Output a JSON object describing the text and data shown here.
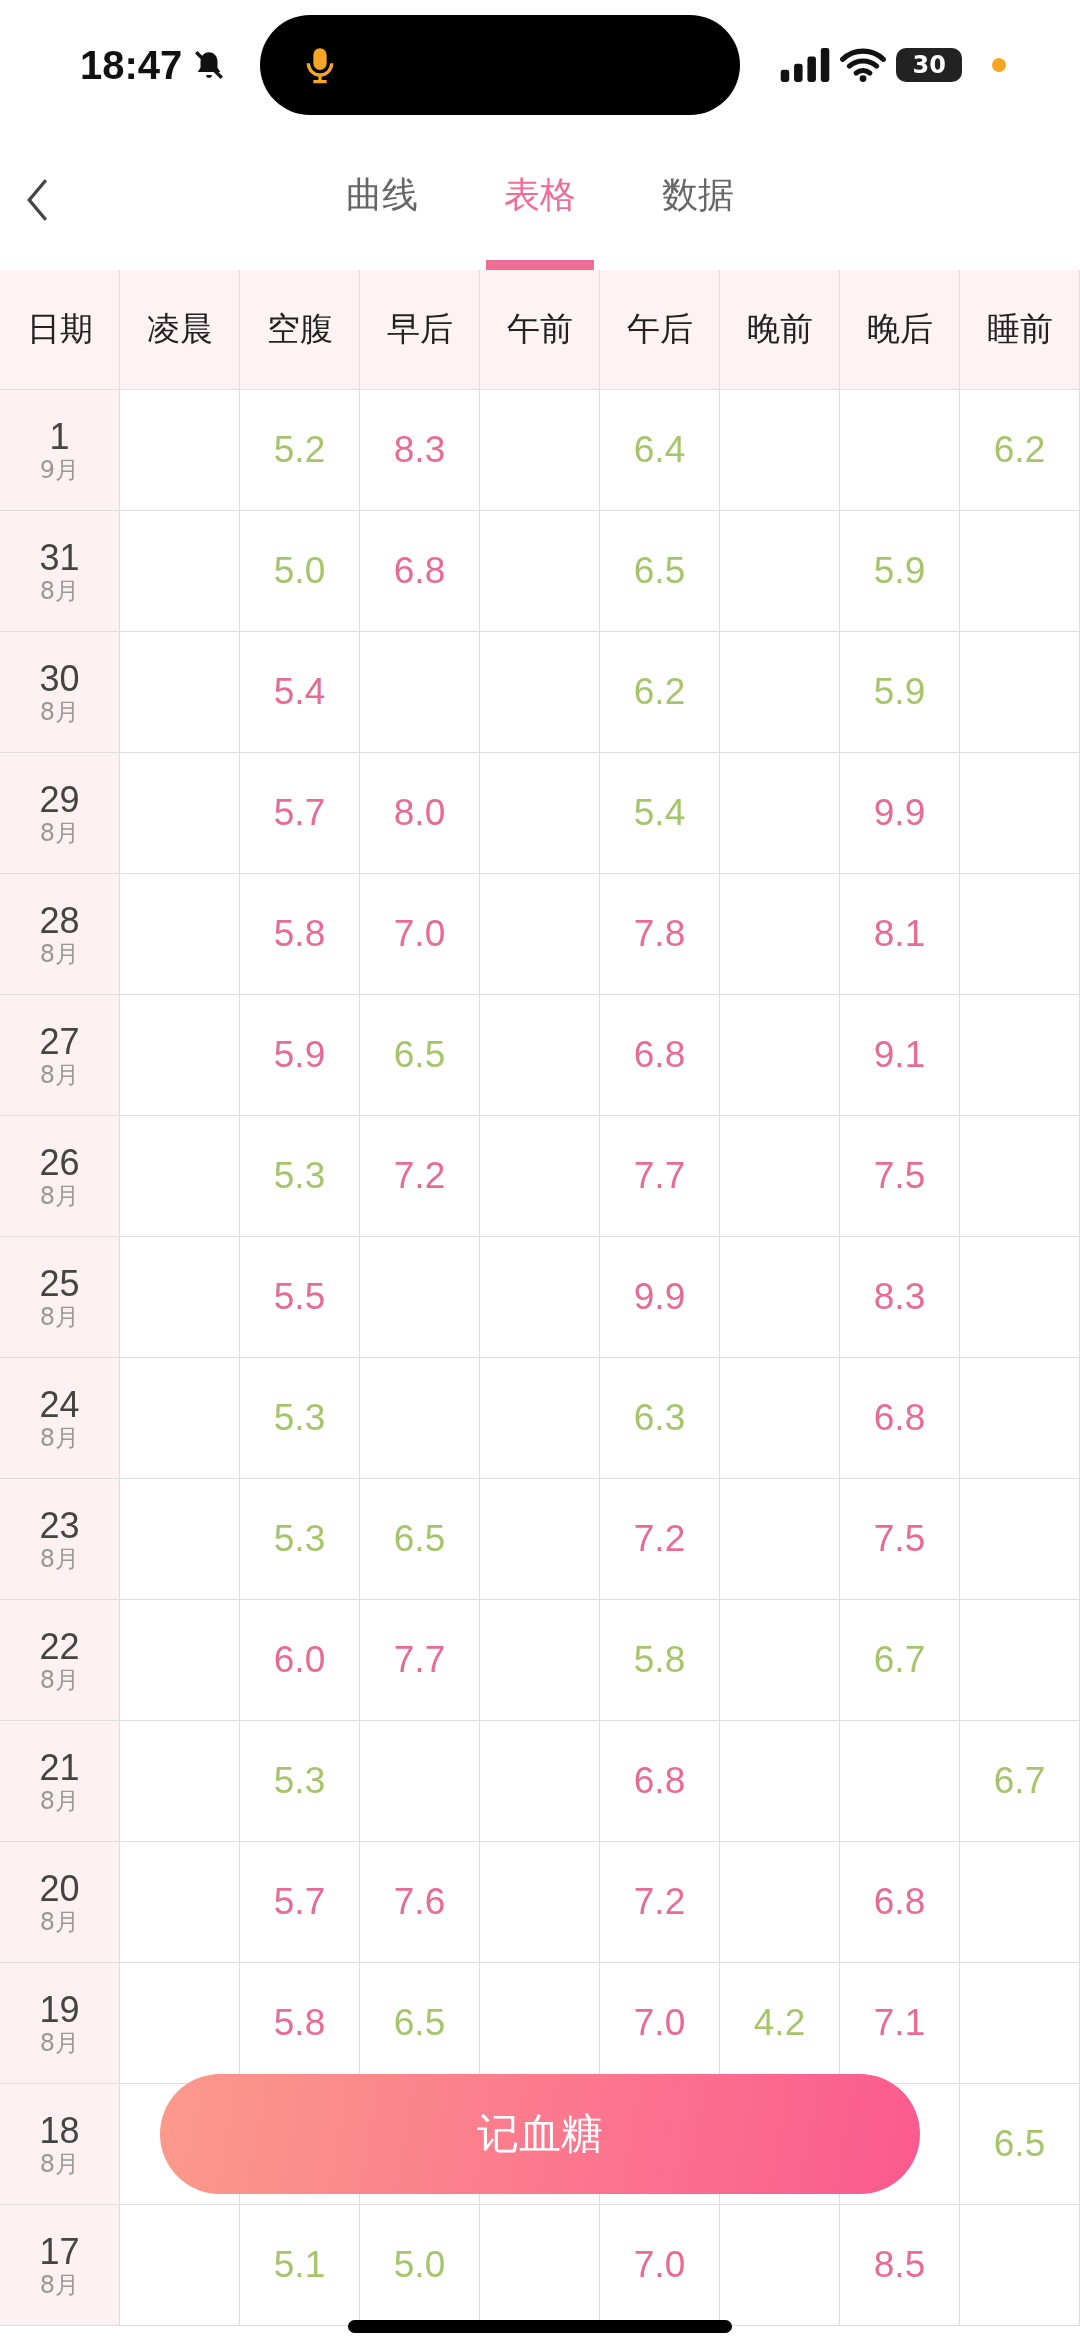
{
  "status_bar": {
    "time": "18:47",
    "battery": "30"
  },
  "tabs": [
    {
      "label": "曲线",
      "selected": false
    },
    {
      "label": "表格",
      "selected": true
    },
    {
      "label": "数据",
      "selected": false
    }
  ],
  "table": {
    "columns": [
      "日期",
      "凌晨",
      "空腹",
      "早后",
      "午前",
      "午后",
      "晚前",
      "晚后",
      "睡前"
    ],
    "rows": [
      {
        "cells": [
          {
            "day": "1",
            "month": "9月"
          },
          null,
          {
            "value": "5.2",
            "high": false
          },
          {
            "value": "8.3",
            "high": true
          },
          null,
          {
            "value": "6.4",
            "high": false
          },
          null,
          null,
          {
            "value": "6.2",
            "high": false
          }
        ]
      },
      {
        "cells": [
          {
            "day": "31",
            "month": "8月"
          },
          null,
          {
            "value": "5.0",
            "high": false
          },
          {
            "value": "6.8",
            "high": true
          },
          null,
          {
            "value": "6.5",
            "high": false
          },
          null,
          {
            "value": "5.9",
            "high": false
          },
          null
        ]
      },
      {
        "cells": [
          {
            "day": "30",
            "month": "8月"
          },
          null,
          {
            "value": "5.4",
            "high": true
          },
          null,
          null,
          {
            "value": "6.2",
            "high": false
          },
          null,
          {
            "value": "5.9",
            "high": false
          },
          null
        ]
      },
      {
        "cells": [
          {
            "day": "29",
            "month": "8月"
          },
          null,
          {
            "value": "5.7",
            "high": true
          },
          {
            "value": "8.0",
            "high": true
          },
          null,
          {
            "value": "5.4",
            "high": false
          },
          null,
          {
            "value": "9.9",
            "high": true
          },
          null
        ]
      },
      {
        "cells": [
          {
            "day": "28",
            "month": "8月"
          },
          null,
          {
            "value": "5.8",
            "high": true
          },
          {
            "value": "7.0",
            "high": true
          },
          null,
          {
            "value": "7.8",
            "high": true
          },
          null,
          {
            "value": "8.1",
            "high": true
          },
          null
        ]
      },
      {
        "cells": [
          {
            "day": "27",
            "month": "8月"
          },
          null,
          {
            "value": "5.9",
            "high": true
          },
          {
            "value": "6.5",
            "high": false
          },
          null,
          {
            "value": "6.8",
            "high": true
          },
          null,
          {
            "value": "9.1",
            "high": true
          },
          null
        ]
      },
      {
        "cells": [
          {
            "day": "26",
            "month": "8月"
          },
          null,
          {
            "value": "5.3",
            "high": false
          },
          {
            "value": "7.2",
            "high": true
          },
          null,
          {
            "value": "7.7",
            "high": true
          },
          null,
          {
            "value": "7.5",
            "high": true
          },
          null
        ]
      },
      {
        "cells": [
          {
            "day": "25",
            "month": "8月"
          },
          null,
          {
            "value": "5.5",
            "high": true
          },
          null,
          null,
          {
            "value": "9.9",
            "high": true
          },
          null,
          {
            "value": "8.3",
            "high": true
          },
          null
        ]
      },
      {
        "cells": [
          {
            "day": "24",
            "month": "8月"
          },
          null,
          {
            "value": "5.3",
            "high": false
          },
          null,
          null,
          {
            "value": "6.3",
            "high": false
          },
          null,
          {
            "value": "6.8",
            "high": true
          },
          null
        ]
      },
      {
        "cells": [
          {
            "day": "23",
            "month": "8月"
          },
          null,
          {
            "value": "5.3",
            "high": false
          },
          {
            "value": "6.5",
            "high": false
          },
          null,
          {
            "value": "7.2",
            "high": true
          },
          null,
          {
            "value": "7.5",
            "high": true
          },
          null
        ]
      },
      {
        "cells": [
          {
            "day": "22",
            "month": "8月"
          },
          null,
          {
            "value": "6.0",
            "high": true
          },
          {
            "value": "7.7",
            "high": true
          },
          null,
          {
            "value": "5.8",
            "high": false
          },
          null,
          {
            "value": "6.7",
            "high": false
          },
          null
        ]
      },
      {
        "cells": [
          {
            "day": "21",
            "month": "8月"
          },
          null,
          {
            "value": "5.3",
            "high": false
          },
          null,
          null,
          {
            "value": "6.8",
            "high": true
          },
          null,
          null,
          {
            "value": "6.7",
            "high": false
          }
        ]
      },
      {
        "cells": [
          {
            "day": "20",
            "month": "8月"
          },
          null,
          {
            "value": "5.7",
            "high": true
          },
          {
            "value": "7.6",
            "high": true
          },
          null,
          {
            "value": "7.2",
            "high": true
          },
          null,
          {
            "value": "6.8",
            "high": true
          },
          null
        ]
      },
      {
        "cells": [
          {
            "day": "19",
            "month": "8月"
          },
          null,
          {
            "value": "5.8",
            "high": true
          },
          {
            "value": "6.5",
            "high": false
          },
          null,
          {
            "value": "7.0",
            "high": true
          },
          {
            "value": "4.2",
            "high": false
          },
          {
            "value": "7.1",
            "high": true
          },
          null
        ]
      },
      {
        "cells": [
          {
            "day": "18",
            "month": "8月"
          },
          null,
          null,
          null,
          null,
          null,
          null,
          null,
          {
            "value": "6.5",
            "high": false
          }
        ]
      },
      {
        "cells": [
          {
            "day": "17",
            "month": "8月"
          },
          null,
          {
            "value": "5.1",
            "high": false
          },
          {
            "value": "5.0",
            "high": false
          },
          null,
          {
            "value": "7.0",
            "high": true
          },
          null,
          {
            "value": "8.5",
            "high": true
          },
          null
        ]
      }
    ]
  },
  "action_button": "记血糖"
}
